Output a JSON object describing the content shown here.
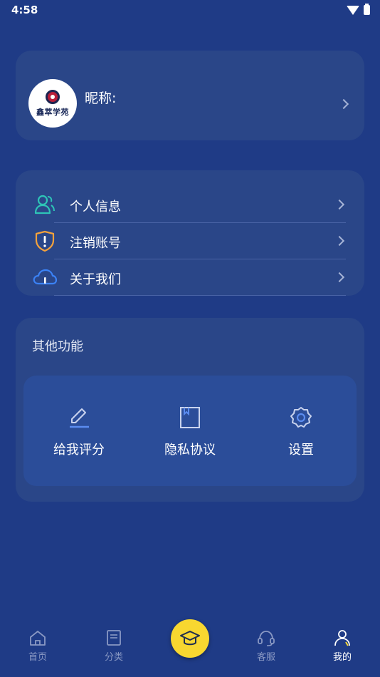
{
  "status_bar": {
    "time": "4:58"
  },
  "profile": {
    "avatar_text": "鑫萃学苑",
    "nickname_label": "昵称:"
  },
  "menu": {
    "items": [
      {
        "label": "个人信息",
        "icon": "person-group-icon",
        "color": "#2ec4b6"
      },
      {
        "label": "注销账号",
        "icon": "shield-alert-icon",
        "color": "#f4a23c"
      },
      {
        "label": "关于我们",
        "icon": "cloud-info-icon",
        "color": "#3b82f6"
      }
    ]
  },
  "other_functions": {
    "title": "其他功能",
    "items": [
      {
        "label": "给我评分",
        "icon": "pencil-icon"
      },
      {
        "label": "隐私协议",
        "icon": "document-icon"
      },
      {
        "label": "设置",
        "icon": "gear-icon"
      }
    ]
  },
  "bottom_nav": {
    "items": [
      {
        "label": "首页",
        "icon": "home-icon",
        "active": false
      },
      {
        "label": "分类",
        "icon": "book-icon",
        "active": false
      },
      {
        "label": "",
        "icon": "graduation-cap-icon",
        "active": false
      },
      {
        "label": "客服",
        "icon": "headset-icon",
        "active": false
      },
      {
        "label": "我的",
        "icon": "user-icon",
        "active": true
      }
    ]
  },
  "colors": {
    "background": "#1f3b86",
    "card": "#2a4688",
    "accent_yellow": "#f8d730",
    "icon_blue": "#5b8cf0"
  }
}
